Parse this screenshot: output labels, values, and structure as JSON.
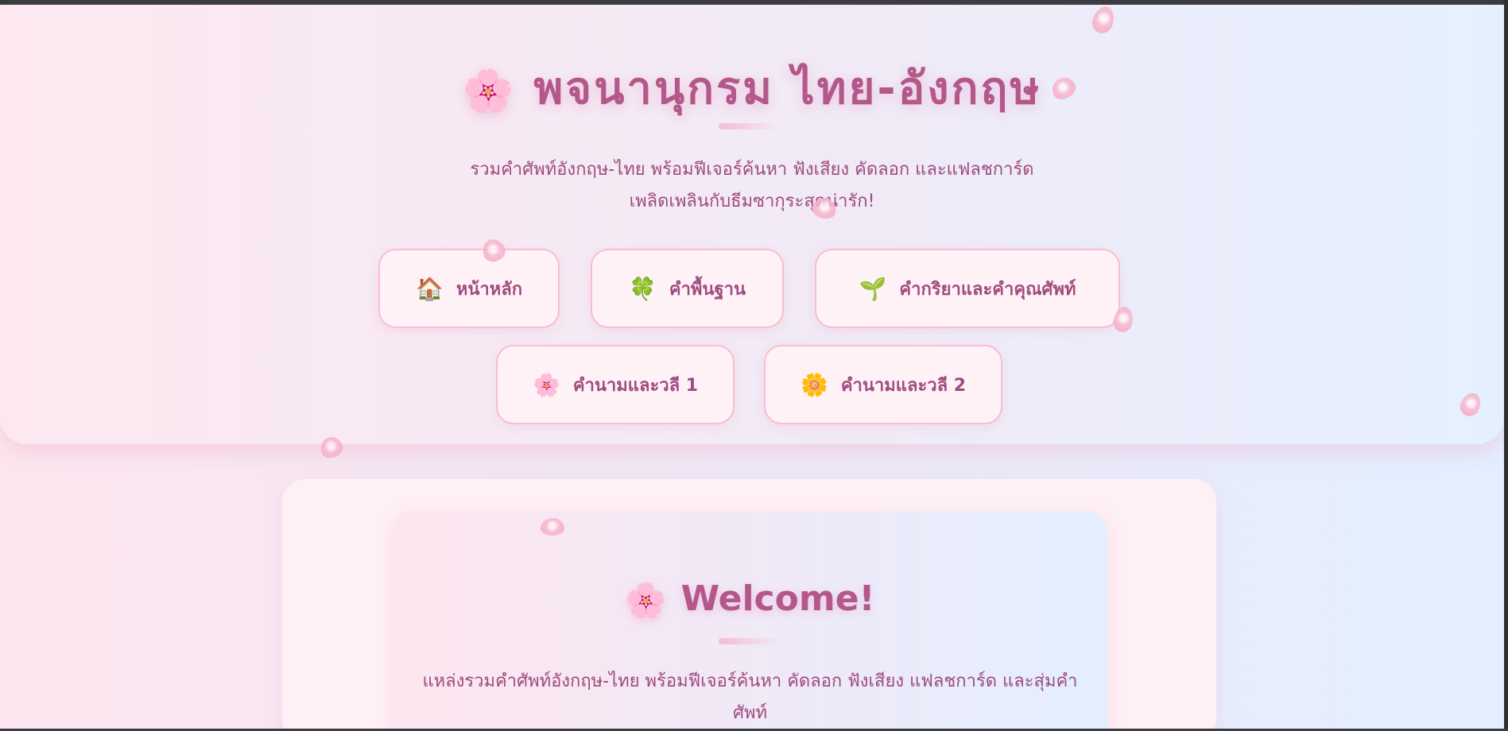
{
  "header": {
    "title": "พจนานุกรม ไทย-อังกฤษ",
    "title_icon": "cherry-blossom-icon",
    "subtitle": "รวมคำศัพท์อังกฤษ-ไทย พร้อมฟีเจอร์ค้นหา ฟังเสียง คัดลอก และแฟลชการ์ด เพลิดเพลินกับธีมซากุระสุดน่ารัก!"
  },
  "nav": {
    "items": [
      {
        "label": "หน้าหลัก",
        "icon": "house-icon",
        "emoji": "🏠"
      },
      {
        "label": "คำพื้นฐาน",
        "icon": "four-leaf-clover-icon",
        "emoji": "🍀"
      },
      {
        "label": "คำกริยาและคำคุณศัพท์",
        "icon": "seedling-icon",
        "emoji": "🌱"
      },
      {
        "label": "คำนามและวลี 1",
        "icon": "cherry-blossom-icon",
        "emoji": "🌸"
      },
      {
        "label": "คำนามและวลี 2",
        "icon": "blossom-icon",
        "emoji": "🌼"
      }
    ]
  },
  "welcome": {
    "title": "Welcome!",
    "title_icon": "cherry-blossom-icon",
    "description": "แหล่งรวมคำศัพท์อังกฤษ-ไทย พร้อมฟีเจอร์ค้นหา คัดลอก ฟังเสียง แฟลชการ์ด และสุ่มคำศัพท์"
  },
  "theme": {
    "accent": "#b4578b",
    "text": "#9e4a80",
    "button_border": "#f8bdd3",
    "button_bg": "#fff2f6",
    "petal": "#f6abc6"
  }
}
